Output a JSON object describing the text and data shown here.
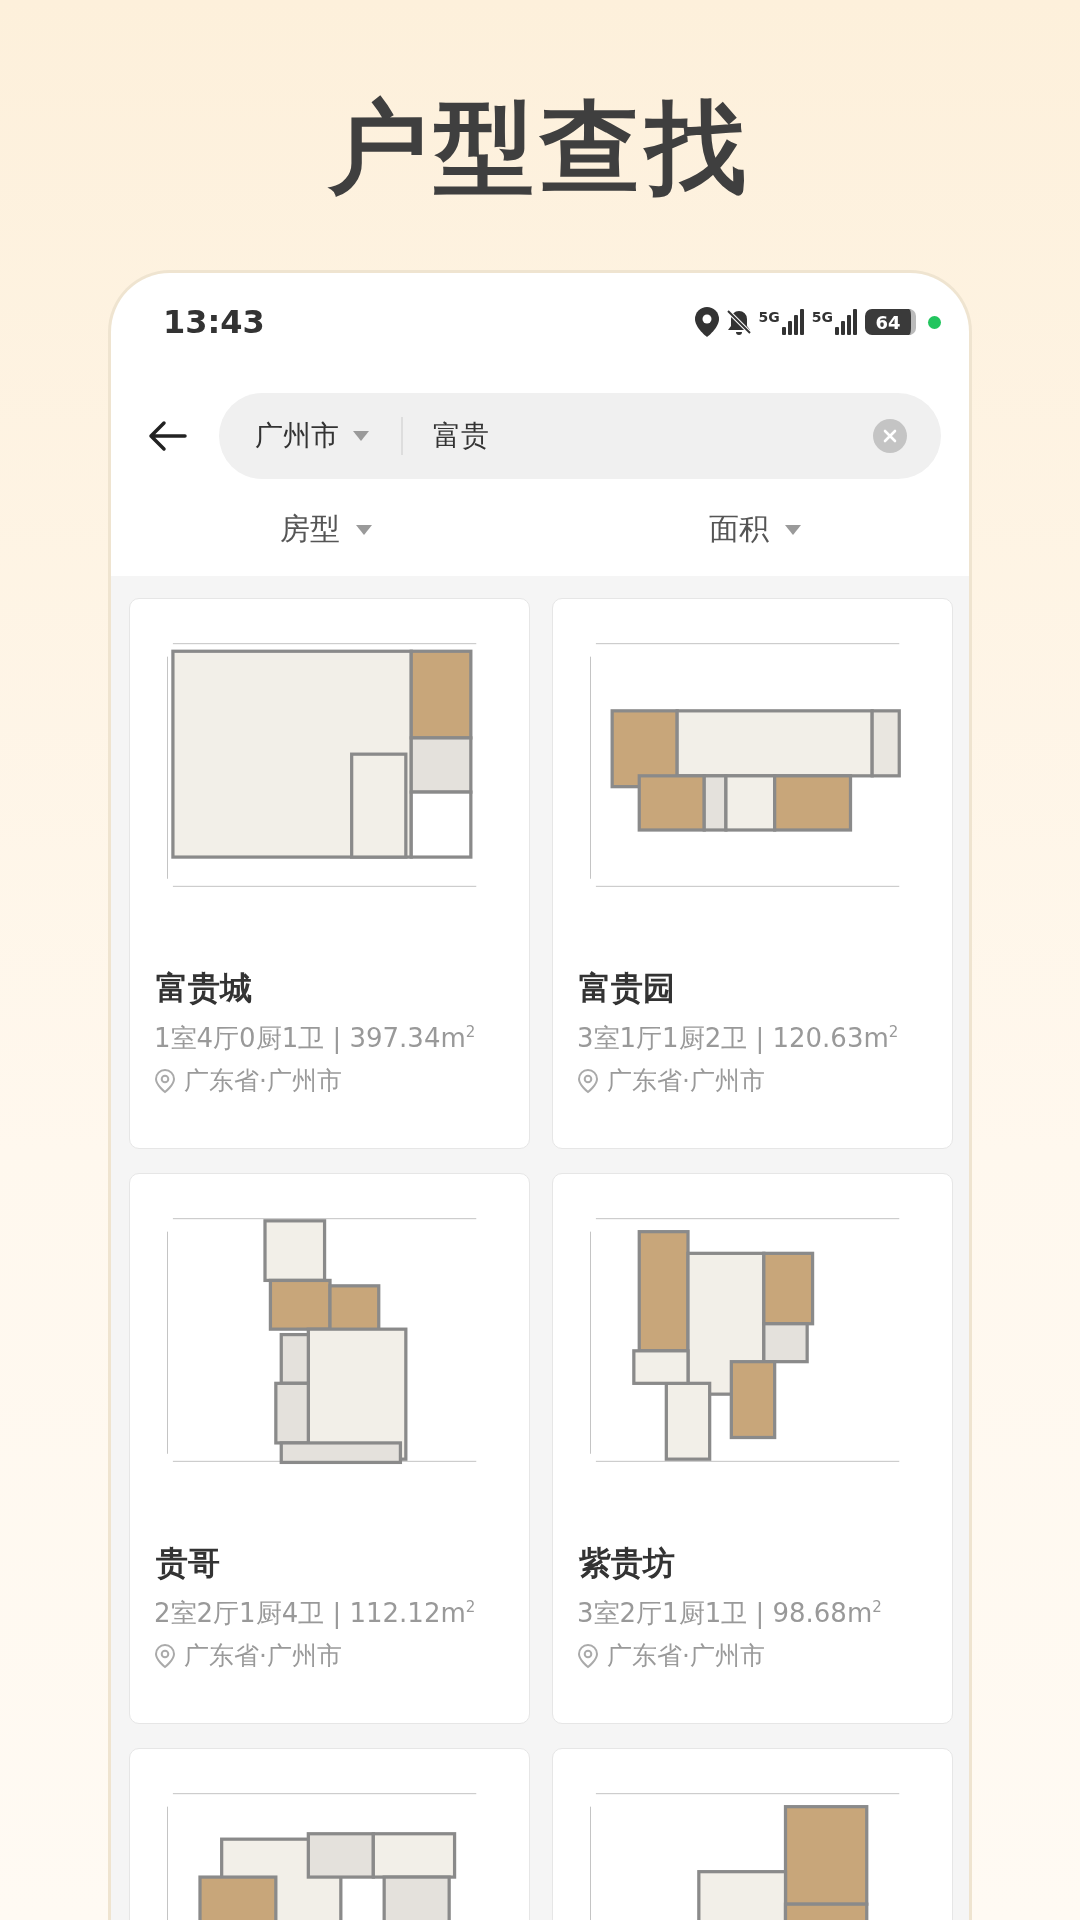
{
  "page_title": "户型查找",
  "status_bar": {
    "time": "13:43",
    "networks": [
      "5G",
      "5G"
    ],
    "battery": "64"
  },
  "search": {
    "city": "广州市",
    "query": "富贵"
  },
  "filters": [
    {
      "label": "房型"
    },
    {
      "label": "面积"
    }
  ],
  "listings": [
    {
      "kind": "listing",
      "name": "富贵城",
      "layout": "1室4厅0厨1卫 | 397.34m$^{2}$",
      "location": "广东省·广州市"
    },
    {
      "kind": "listing",
      "name": "富贵园",
      "layout": "3室1厅1厨2卫 | 120.63m$^{2}$",
      "location": "广东省·广州市"
    },
    {
      "kind": "listing",
      "name": "贵哥",
      "layout": "2室2厅1厨4卫 | 112.12m$^{2}$",
      "location": "广东省·广州市"
    },
    {
      "kind": "listing",
      "name": "紫贵坊",
      "layout": "3室2厅1厨1卫 | 98.68m$^{2}$",
      "location": "广东省·广州市"
    },
    {
      "kind": "image_only"
    },
    {
      "kind": "image_only"
    }
  ]
}
